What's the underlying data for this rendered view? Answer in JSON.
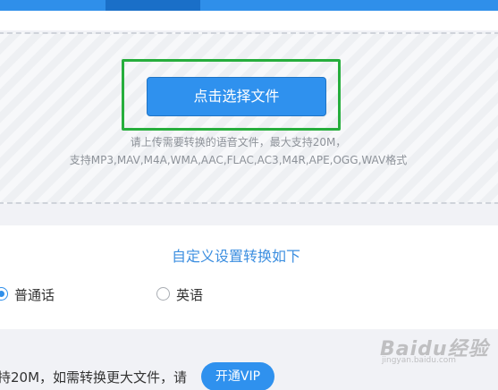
{
  "upload": {
    "button_label": "点击选择文件",
    "hint_line1": "请上传需要转换的语音文件，最大支持20M，",
    "hint_line2": "支持MP3,MAV,M4A,WMA,AAC,FLAC,AC3,M4R,APE,OGG,WAV格式"
  },
  "settings": {
    "title": "自定义设置转换如下",
    "language_options": [
      {
        "label": "普通话",
        "checked": true
      },
      {
        "label": "英语",
        "checked": false
      }
    ]
  },
  "bottom": {
    "text": "持20M，如需转换更大文件，请",
    "vip_button_label": "开通VIP"
  },
  "watermark": {
    "text": "Baidu经验",
    "subtext": "jingyan.baidu.com"
  },
  "colors": {
    "accent": "#2f91ee",
    "highlight": "#27ae3d",
    "title": "#3d8fe0"
  }
}
